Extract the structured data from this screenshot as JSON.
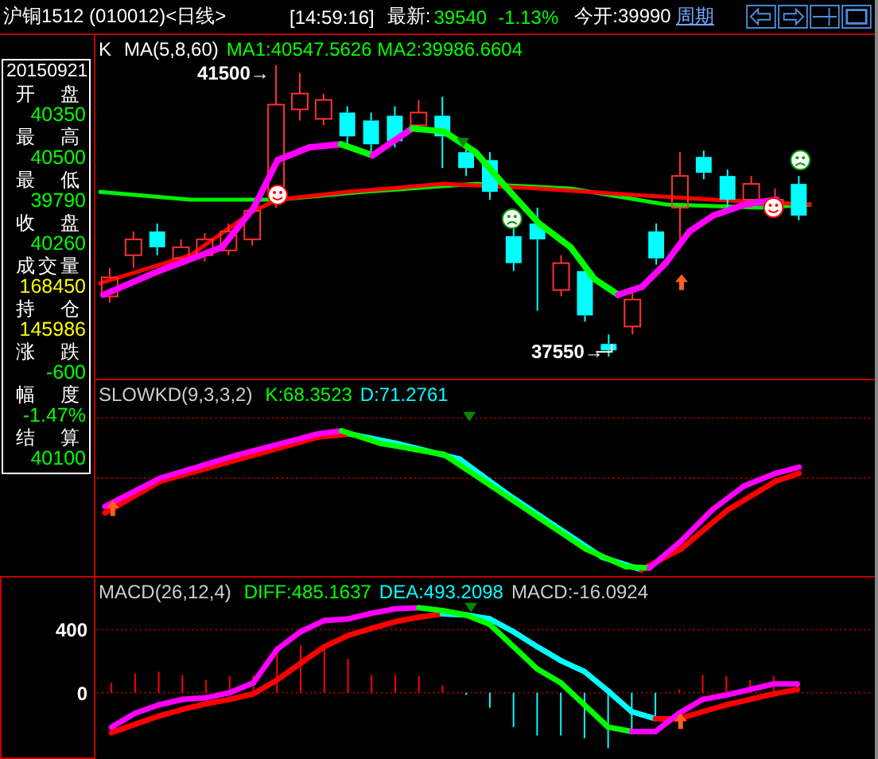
{
  "header": {
    "instrument": "沪铜1512 (010012)<日线>",
    "time": "[14:59:16]",
    "latest_label": "最新:",
    "latest_value": "39540",
    "change": "-1.13%",
    "open_label": "今开:39990",
    "period_link": "周期"
  },
  "info_panel": {
    "date": "20150921",
    "fields": [
      {
        "label": "开 盘",
        "value": "40350",
        "color": "#00ff00"
      },
      {
        "label": "最 高",
        "value": "40500",
        "color": "#00ff00"
      },
      {
        "label": "最 低",
        "value": "39790",
        "color": "#00ff00"
      },
      {
        "label": "收 盘",
        "value": "40260",
        "color": "#00ff00"
      },
      {
        "label": "成交量",
        "value": "168450",
        "color": "#ffff00"
      },
      {
        "label": "持 仓",
        "value": "145986",
        "color": "#ffff00"
      },
      {
        "label": "涨 跌",
        "value": "-600",
        "color": "#00ff00"
      },
      {
        "label": "幅 度",
        "value": "-1.47%",
        "color": "#00ff00"
      },
      {
        "label": "结 算",
        "value": "40100",
        "color": "#00ff00"
      }
    ]
  },
  "main_panel": {
    "indicator": "K",
    "ma_params": "MA(5,8,60)",
    "ma_values": "MA1:40547.5626 MA2:39986.6604",
    "high_mark": "41500→",
    "low_mark": "37550→"
  },
  "kd_panel": {
    "indicator": "SLOWKD(9,3,3,2)",
    "k_value": "K:68.3523",
    "d_value": "D:71.2761"
  },
  "macd_panel": {
    "indicator": "MACD(26,12,4)",
    "diff_value": "DIFF:485.1637",
    "dea_value": "DEA:493.2098",
    "macd_value": "MACD:-16.0924",
    "axis_labels": [
      "400",
      "0"
    ]
  }
}
